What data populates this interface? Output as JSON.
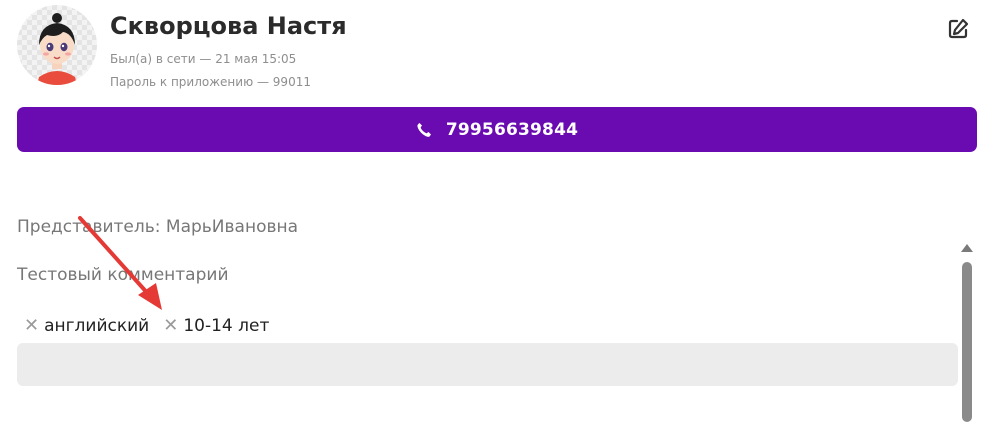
{
  "profile": {
    "name": "Скворцова Настя",
    "online": "Был(а) в сети — 21 мая 15:05",
    "app_password": "Пароль к приложению — 99011",
    "avatar_icon": "avatar-cartoon-girl",
    "edit_icon": "edit-icon"
  },
  "phone": {
    "icon": "phone-icon",
    "number": "79956639844",
    "color": "#6a0bb2"
  },
  "details": {
    "representative": "Представитель: МарьИвановна",
    "comment": "Тестовый комментарий"
  },
  "tags": [
    {
      "label": "английский",
      "remove_icon": "✕"
    },
    {
      "label": "10-14 лет",
      "remove_icon": "✕"
    }
  ],
  "tag_input": {
    "value": "",
    "placeholder": ""
  },
  "annotation": {
    "arrow_color": "#e53935"
  }
}
